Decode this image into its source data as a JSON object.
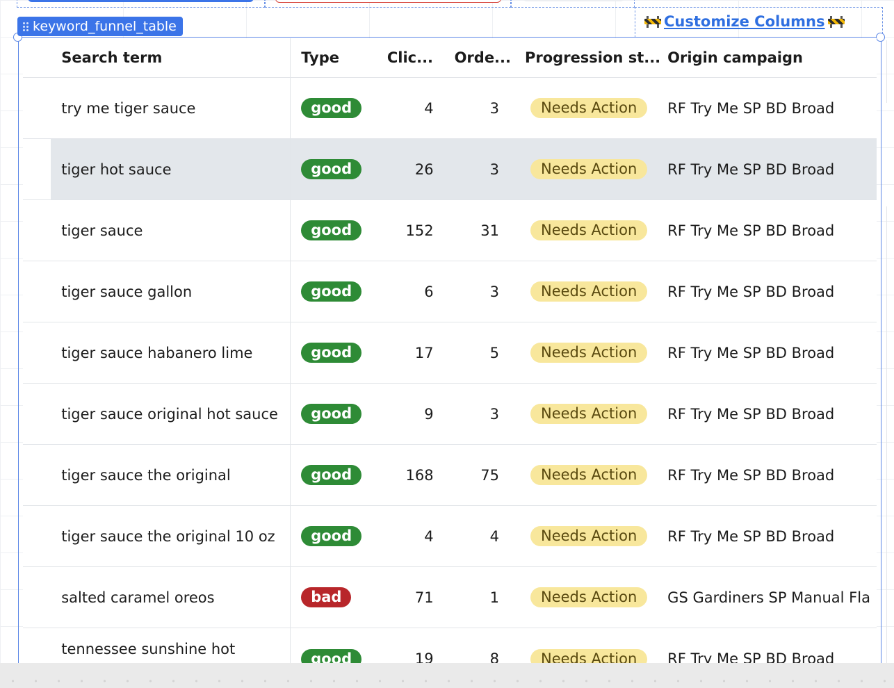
{
  "component_tag": "keyword_funnel_table",
  "customize_columns_label": "Customize Columns",
  "colors": {
    "accent": "#3b74e8",
    "good": "#2e8b36",
    "bad": "#b8262a",
    "needs_action": "#f8e79c",
    "row_highlight": "#e3e7eb"
  },
  "table": {
    "headers": {
      "search_term": "Search term",
      "type": "Type",
      "clicks": "Clic...",
      "orders": "Orde...",
      "progression_status": "Progression st...",
      "origin_campaign": "Origin campaign"
    },
    "rows": [
      {
        "search_term": "try me tiger sauce",
        "type": "good",
        "clicks": "4",
        "orders": "3",
        "status": "Needs Action",
        "campaign": "RF Try Me SP BD Broad"
      },
      {
        "search_term": "tiger hot sauce",
        "type": "good",
        "clicks": "26",
        "orders": "3",
        "status": "Needs Action",
        "campaign": "RF Try Me SP BD Broad"
      },
      {
        "search_term": "tiger sauce",
        "type": "good",
        "clicks": "152",
        "orders": "31",
        "status": "Needs Action",
        "campaign": "RF Try Me SP BD Broad"
      },
      {
        "search_term": "tiger sauce gallon",
        "type": "good",
        "clicks": "6",
        "orders": "3",
        "status": "Needs Action",
        "campaign": "RF Try Me SP BD Broad"
      },
      {
        "search_term": "tiger sauce habanero lime",
        "type": "good",
        "clicks": "17",
        "orders": "5",
        "status": "Needs Action",
        "campaign": "RF Try Me SP BD Broad"
      },
      {
        "search_term": "tiger sauce original hot sauce",
        "type": "good",
        "clicks": "9",
        "orders": "3",
        "status": "Needs Action",
        "campaign": "RF Try Me SP BD Broad"
      },
      {
        "search_term": "tiger sauce the original",
        "type": "good",
        "clicks": "168",
        "orders": "75",
        "status": "Needs Action",
        "campaign": "RF Try Me SP BD Broad"
      },
      {
        "search_term": "tiger sauce the original 10 oz",
        "type": "good",
        "clicks": "4",
        "orders": "4",
        "status": "Needs Action",
        "campaign": "RF Try Me SP BD Broad"
      },
      {
        "search_term": "salted caramel oreos",
        "type": "bad",
        "clicks": "71",
        "orders": "1",
        "status": "Needs Action",
        "campaign": "GS Gardiners SP Manual Fla"
      },
      {
        "search_term": "tennessee sunshine hot",
        "type": "good",
        "clicks": "19",
        "orders": "8",
        "status": "Needs Action",
        "campaign": "RF Try Me SP BD Broad"
      }
    ]
  }
}
